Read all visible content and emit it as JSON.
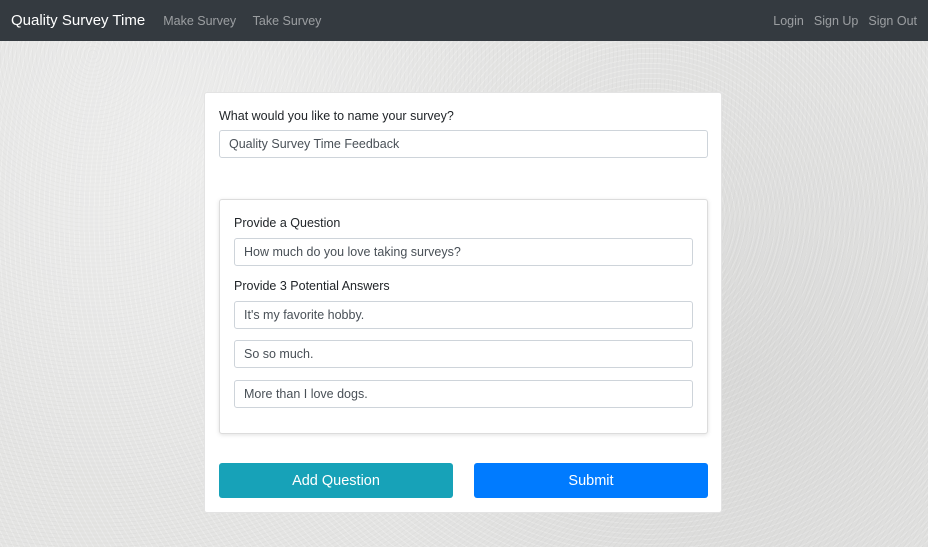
{
  "navbar": {
    "brand": "Quality Survey Time",
    "left_links": [
      "Make Survey",
      "Take Survey"
    ],
    "right_links": [
      "Login",
      "Sign Up",
      "Sign Out"
    ]
  },
  "survey": {
    "name_label": "What would you like to name your survey?",
    "name_value": "Quality Survey Time Feedback",
    "question_label": "Provide a Question",
    "question_value": "How much do you love taking surveys?",
    "answers_label": "Provide 3 Potential Answers",
    "answers": [
      "It's my favorite hobby.",
      "So so much.",
      "More than I love dogs."
    ]
  },
  "buttons": {
    "add_question": "Add Question",
    "submit": "Submit"
  },
  "colors": {
    "navbar": "#343a40",
    "add_question": "#17a2b8",
    "submit": "#007bff"
  }
}
